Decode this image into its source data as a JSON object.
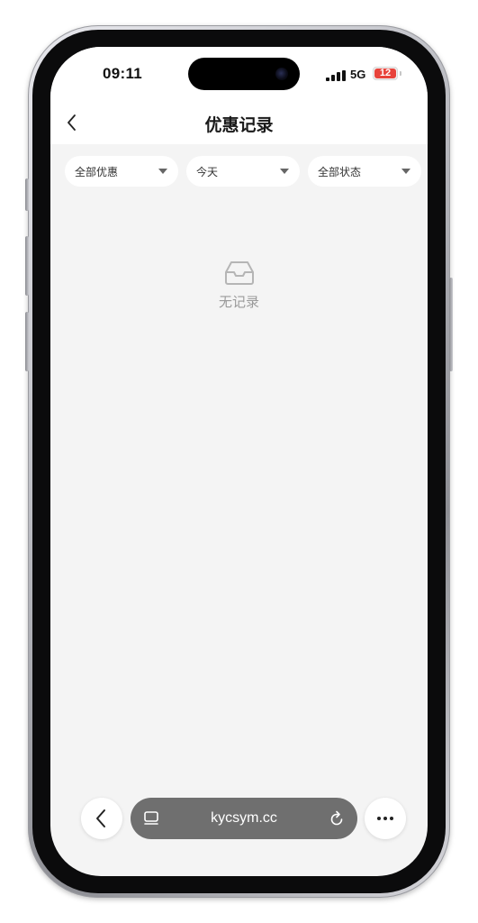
{
  "status_bar": {
    "time": "09:11",
    "network": "5G",
    "battery": "12"
  },
  "navbar": {
    "title": "优惠记录"
  },
  "filters": [
    {
      "label": "全部优惠"
    },
    {
      "label": "今天"
    },
    {
      "label": "全部状态"
    }
  ],
  "empty_state": {
    "text": "无记录",
    "icon": "inbox-icon"
  },
  "browser_toolbar": {
    "url": "kycsym.cc"
  },
  "colors": {
    "background": "#f4f4f4",
    "battery_low": "#e8433b",
    "url_bar": "#6f6f6f"
  }
}
